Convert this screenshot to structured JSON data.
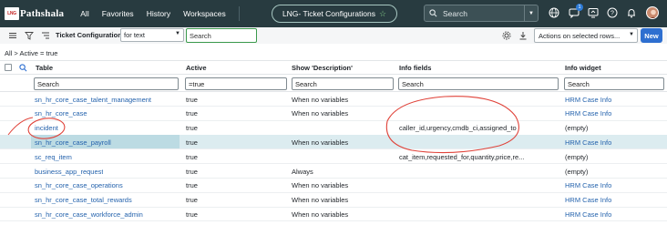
{
  "header": {
    "logo_badge": "LNG",
    "logo_text": "Pathshala",
    "nav": [
      "All",
      "Favorites",
      "History",
      "Workspaces"
    ],
    "title_pill": "LNG- Ticket Configurations",
    "search_placeholder": "Search",
    "notification_count": "1"
  },
  "toolbar": {
    "list_title": "Ticket Configurations",
    "search_field_select": "for text",
    "search_placeholder": "Search",
    "actions_select": "Actions on selected rows...",
    "new_button": "New"
  },
  "breadcrumb": "All > Active = true",
  "table": {
    "columns": [
      "Table",
      "Active",
      "Show 'Description'",
      "Info fields",
      "Info widget"
    ],
    "filters": [
      "Search",
      "=true",
      "Search",
      "Search",
      "Search"
    ],
    "rows": [
      {
        "table": "sn_hr_core_case_talent_management",
        "active": "true",
        "desc": "When no variables",
        "info": "",
        "widget": "HRM Case Info"
      },
      {
        "table": "sn_hr_core_case",
        "active": "true",
        "desc": "When no variables",
        "info": "",
        "widget": "HRM Case Info"
      },
      {
        "table": "incident",
        "active": "true",
        "desc": "",
        "info": "caller_id,urgency,cmdb_ci,assigned_to",
        "widget": "(empty)"
      },
      {
        "table": "sn_hr_core_case_payroll",
        "active": "true",
        "desc": "When no variables",
        "info": "",
        "widget": "HRM Case Info"
      },
      {
        "table": "sc_req_item",
        "active": "true",
        "desc": "",
        "info": "cat_item,requested_for,quantity,price,re...",
        "widget": "(empty)"
      },
      {
        "table": "business_app_request",
        "active": "true",
        "desc": "Always",
        "info": "",
        "widget": "(empty)"
      },
      {
        "table": "sn_hr_core_case_operations",
        "active": "true",
        "desc": "When no variables",
        "info": "",
        "widget": "HRM Case Info"
      },
      {
        "table": "sn_hr_core_case_total_rewards",
        "active": "true",
        "desc": "When no variables",
        "info": "",
        "widget": "HRM Case Info"
      },
      {
        "table": "sn_hr_core_case_workforce_admin",
        "active": "true",
        "desc": "When no variables",
        "info": "",
        "widget": "HRM Case Info"
      }
    ]
  },
  "colors": {
    "nav_bg": "#283b40",
    "link": "#2563ad",
    "new_button": "#2e6fd0",
    "highlight_row": "#dcecf0",
    "annotation": "#e0433a"
  }
}
